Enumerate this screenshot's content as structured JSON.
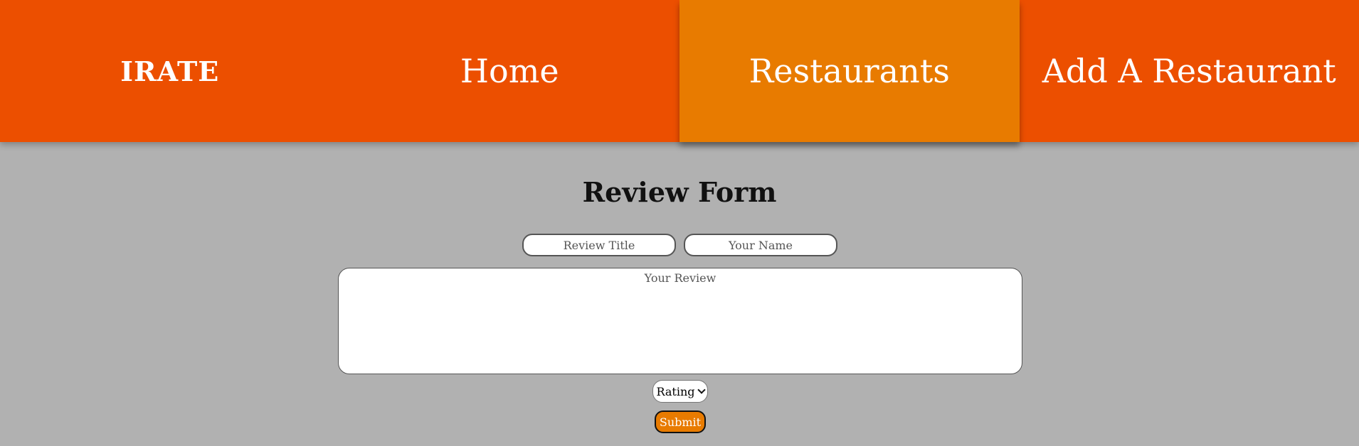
{
  "nav": {
    "logo": "iRate",
    "items": [
      {
        "label": "Home",
        "active": false
      },
      {
        "label": "Restaurants",
        "active": true
      },
      {
        "label": "Add A Restaurant",
        "active": false
      }
    ]
  },
  "colors": {
    "nav_bg": "#ec4f00",
    "nav_active": "#e87b00",
    "page_bg": "#b1b1b1",
    "submit_bg": "#e87b00"
  },
  "form": {
    "title": "Review Form",
    "review_title_placeholder": "Review Title",
    "name_placeholder": "Your Name",
    "review_placeholder": "Your Review",
    "rating_label": "Rating",
    "submit_label": "Submit"
  }
}
